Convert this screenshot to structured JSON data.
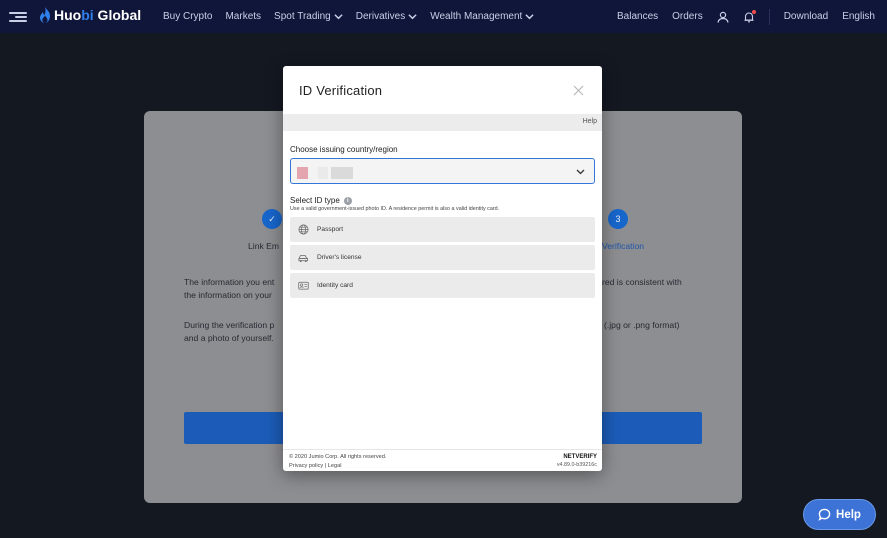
{
  "brand": {
    "part1": "Huo",
    "part2": "bi",
    "part3": " Global"
  },
  "nav": {
    "items": [
      {
        "label": "Buy Crypto",
        "has_dropdown": false
      },
      {
        "label": "Markets",
        "has_dropdown": false
      },
      {
        "label": "Spot Trading",
        "has_dropdown": true
      },
      {
        "label": "Derivatives",
        "has_dropdown": true
      },
      {
        "label": "Wealth Management",
        "has_dropdown": true
      }
    ],
    "balances": "Balances",
    "orders": "Orders",
    "download": "Download",
    "language": "English"
  },
  "background": {
    "step1_check": "✓",
    "step1_label": "Link Em",
    "step3_number": "3",
    "step3_label": "Verification",
    "para1_line1_left": "The information you ent",
    "para1_line1_right": "red is consistent with",
    "para1_line2_left": "the information on your",
    "para2_line1_left": "During the verification p",
    "para2_line1_right": "(.jpg or .png format)",
    "para2_line2_left": "and a photo of yourself."
  },
  "modal": {
    "title": "ID Verification",
    "help": "Help",
    "country_label": "Choose issuing country/region",
    "id_type_label": "Select ID type",
    "id_type_hint": "Use a valid government-issued photo ID. A residence permit is also a valid identity card.",
    "options": [
      {
        "label": "Passport",
        "icon": "globe-icon"
      },
      {
        "label": "Driver's license",
        "icon": "car-icon"
      },
      {
        "label": "Identity card",
        "icon": "id-card-icon"
      }
    ],
    "footer_copyright": "© 2020 Jumio Corp. All rights reserved.",
    "footer_links": "Privacy policy | Legal",
    "footer_brand": "NETVERIFY",
    "footer_version": "v4.89.0-b39216c"
  },
  "help_button": "Help",
  "colors": {
    "accent": "#1766cc",
    "topbar": "#10163a",
    "help_fab": "#3d73d6"
  }
}
